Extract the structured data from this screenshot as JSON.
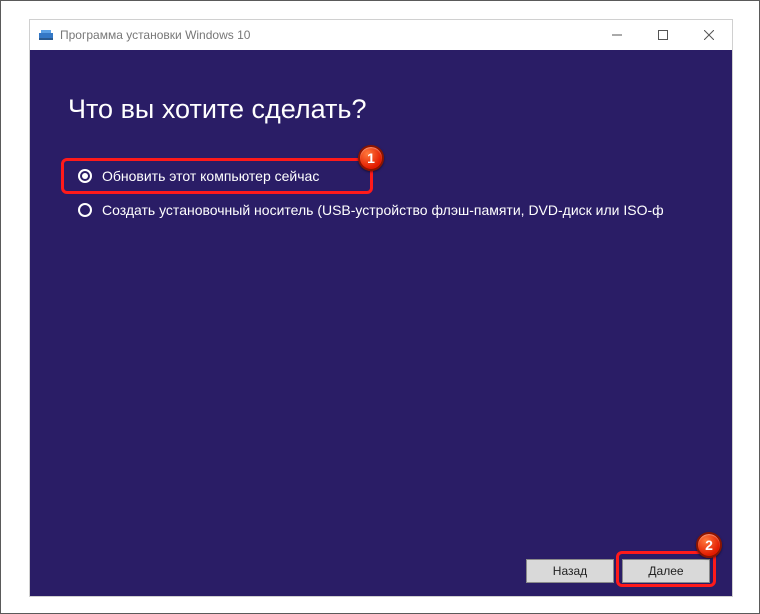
{
  "window": {
    "title": "Программа установки Windows 10"
  },
  "content": {
    "heading": "Что вы хотите сделать?",
    "options": [
      {
        "label": "Обновить этот компьютер сейчас",
        "selected": true
      },
      {
        "label": "Создать установочный носитель (USB-устройство флэш-памяти, DVD-диск или ISO-ф",
        "selected": false
      }
    ]
  },
  "footer": {
    "back": "Назад",
    "next": "Далее"
  },
  "annotations": {
    "badge1": "1",
    "badge2": "2"
  }
}
